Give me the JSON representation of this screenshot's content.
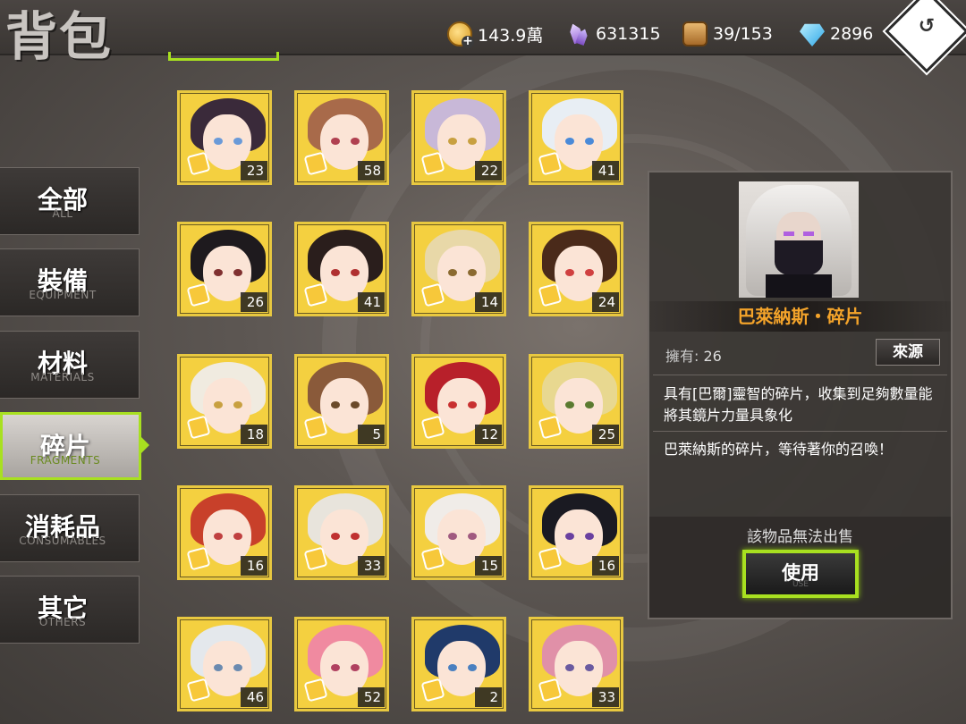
{
  "header": {
    "title": "背包",
    "resources": [
      {
        "icon": "gold-coin-icon",
        "value": "143.9萬"
      },
      {
        "icon": "crystal-icon",
        "value": "631315"
      },
      {
        "icon": "bag-capacity-icon",
        "value": "39/153"
      },
      {
        "icon": "diamond-icon",
        "value": "2896"
      }
    ],
    "back_icon": "back-arrow-icon",
    "back_glyph": "↺"
  },
  "sidebar": {
    "tabs": [
      {
        "zh": "全部",
        "en": "ALL"
      },
      {
        "zh": "裝備",
        "en": "EQUIPMENT"
      },
      {
        "zh": "材料",
        "en": "MATERIALS"
      },
      {
        "zh": "碎片",
        "en": "FRAGMENTS",
        "active": true
      },
      {
        "zh": "消耗品",
        "en": "CONSUMABLES"
      },
      {
        "zh": "其它",
        "en": "OTHERS"
      }
    ]
  },
  "grid": {
    "items": [
      {
        "count": "23"
      },
      {
        "count": "58"
      },
      {
        "count": "22"
      },
      {
        "count": "41"
      },
      {
        "count": "26"
      },
      {
        "count": "41"
      },
      {
        "count": "14"
      },
      {
        "count": "24"
      },
      {
        "count": "18"
      },
      {
        "count": "5"
      },
      {
        "count": "12"
      },
      {
        "count": "25"
      },
      {
        "count": "16"
      },
      {
        "count": "33"
      },
      {
        "count": "15"
      },
      {
        "count": "16"
      },
      {
        "count": "46"
      },
      {
        "count": "52"
      },
      {
        "count": "2"
      },
      {
        "count": "33"
      }
    ]
  },
  "detail": {
    "name": "巴萊納斯・碎片",
    "own_label": "擁有:",
    "own_value": "26",
    "source_label": "來源",
    "desc1": "具有[巴爾]靈智的碎片，收集到足夠數量能將其鏡片力量具象化",
    "desc2": "巴萊納斯的碎片，等待著你的召喚！",
    "no_sale": "該物品無法出售",
    "use_label": "使用",
    "use_en": "USE"
  },
  "colors": {
    "accent_green": "#a8e020",
    "name_orange": "#f3a32a",
    "frame_gold": "#e8c840"
  }
}
